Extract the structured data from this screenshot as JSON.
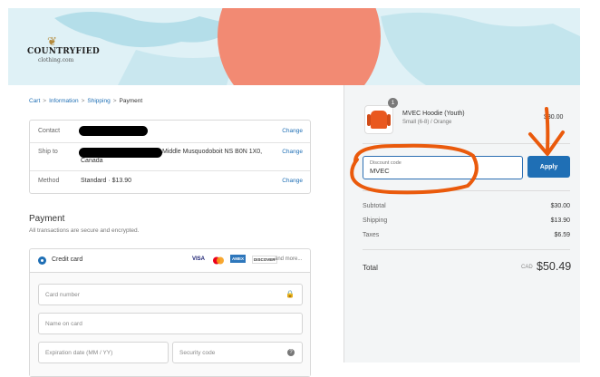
{
  "store": {
    "name": "COUNTRYFIED",
    "tagline": "clothing.com"
  },
  "breadcrumb": {
    "cart": "Cart",
    "information": "Information",
    "shipping": "Shipping",
    "payment": "Payment",
    "separator": ">"
  },
  "review": {
    "contact_label": "Contact",
    "ship_label": "Ship to",
    "ship_address_partial": "Middle Musquodoboit NS B0N 1X0,",
    "ship_country": "Canada",
    "method_label": "Method",
    "method_value": "Standard · $13.90",
    "change": "Change"
  },
  "payment": {
    "title": "Payment",
    "subtitle": "All transactions are secure and encrypted.",
    "credit_card_label": "Credit card",
    "brands": {
      "visa": "VISA",
      "amex": "AMEX",
      "discover": "DISCOVER",
      "more": "and more..."
    },
    "card_number_placeholder": "Card number",
    "name_placeholder": "Name on card",
    "expiry_placeholder": "Expiration date (MM / YY)",
    "security_placeholder": "Security code"
  },
  "order": {
    "item_name": "MVEC Hoodie (Youth)",
    "item_variant": "Small (6-8) / Orange",
    "item_qty": "1",
    "item_price": "$30.00",
    "discount_label": "Discount code",
    "discount_value": "MVEC",
    "apply_label": "Apply",
    "subtotal_label": "Subtotal",
    "subtotal": "$30.00",
    "shipping_label": "Shipping",
    "shipping": "$13.90",
    "taxes_label": "Taxes",
    "taxes": "$6.59",
    "total_label": "Total",
    "currency": "CAD",
    "total": "$50.49"
  },
  "colors": {
    "accent": "#1f6fb5",
    "annotation": "#ea5a0c",
    "hero_bg": "#dff1f6",
    "panel_bg": "#f3f5f6"
  }
}
